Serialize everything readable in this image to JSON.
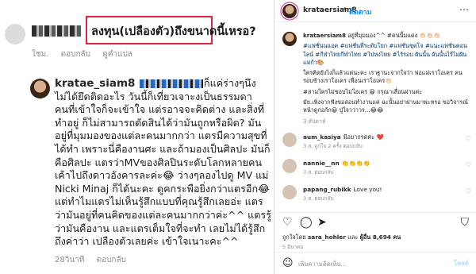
{
  "left": {
    "first_comment": {
      "text": "ลงทุน(เปลืองตัว)ถึงขนาดนี้เหรอ?",
      "time": "ใชม.",
      "reply_label": "ตอบกลับ",
      "translation_label": "ดูคำแปล"
    },
    "reply": {
      "username": "kratae_siam8",
      "lines": [
        "ก็แค่ร่างๆนึง",
        "ไม่ได้ยึดติดอะไร วันนี้ก็เที่ยวเจาะงเป็นธรรมดา",
        "คนที่เข้าใจก็จะเข้าใจ แต่รอาจจะคิดต่าง และสิ่งที่",
        "ทำอยู่ ก็ไม่สามารถตัดสินได้ว่ามันถูกหรือผิด? มัน",
        "อยู่ที่มุมมองของแต่ละคนมากกว่า แตรมีความสุขที่",
        "ได้ทำ เพราะนี่คืองานศะ และถ้ามองเป็นศิลปะ มันก็",
        "คือศิลปะ แตรว่าMVของศิลปินระดับโลกหลายคน",
        "เค้าไปถึงดาวอังคารละค่ะ😂 ว่างๆลองไปดู MV แม่",
        "Nicki Minaj ก็ได้นะคะ ดูคกระพือยิ่งกว่าแตรอีก😂",
        "แต่ทำไมแตรไม่เห็นรู้สึกแบบที่คุณรู้สึกเลยอ่ะ แตร",
        "ว่ามันอยู่ที่คนคิดของแต่ละคนมากกว่าค่ะ^^ แตรรู้",
        "ว่ามันคืองาน และแตรเต็มใจที่จะทำ เลยไม่ได้รู้สึก",
        "ถึงค่าว่า เปลืองตัวเลยค่ะ เข้าใจเนาะคะ^^"
      ],
      "time": "28วินาที",
      "reply_label": "ตอบกลับ"
    }
  },
  "post": {
    "header": {
      "username": "krataersiam8",
      "dot": "•",
      "follow_label": "ติดตาม",
      "more_icon": "more-icon"
    },
    "caption": {
      "username": "krataersiam8",
      "text": "อยู่ที่มุมมอง^^ #คนนี้มแดง 👏🏻👏🏻👏🏻",
      "hashtags": "#แฟชั่นนแอค #แฟชั่นที่ระดับโยก #แฟชั่นชุดโจ #แนะแฟชั่นคอนไลน์ #กีฬาไทยกีฬาไทย #ไปหงไทย #ไร้รอบ ผันนั้น ผันนั้นไร้ไม่ผันแม่ก้า🎨",
      "para2": "ใครคิดยังไงก็แล้วแต่นะคะ เราฐานะจากใจว่า พ่อแม่เราโอเคร คนรอบข้างเราโอเคร เพื่อนเราโอเคร👏🏻",
      "para3": "#สามใครไม่ชอบไม่โอเคร 😀 กรุณาเลื่อนผ่านค่ะ",
      "para4": "มัย.เพิ่งจากฟังขอสอนทำงานแค่ ฉะนั้นอย่าผ่านมาพ่ะหรอ ขอวิจารณ์หน้าดูก่อก้ก😀 ปู่ใจวว่าวร...😂😂",
      "time": "3 สัปดาห์"
    },
    "comments": [
      {
        "user": "aum_kasiya",
        "text": "มีอยากรดค่ะ ❤️",
        "meta": "3 ส. ถูกใจ 2 ครั้ง ตอบกลับ"
      },
      {
        "user": "nannie__nn",
        "text": "👏👏👏👏",
        "meta": "3 ส. ตอบกลับ"
      },
      {
        "user": "papang_rubikk",
        "text": "Love you!",
        "meta": "3 ส. ตอบกลับ"
      }
    ],
    "likes": {
      "prefix": "ถูกใจโดย",
      "user": "sara_hohler",
      "suffix": "และ",
      "others": "ผู้อื่น 8,694 คน"
    },
    "date": "5 มีนาคม",
    "add_comment": {
      "placeholder": "เพิ่มความคิดเห็น...",
      "post_label": "โพสต์"
    },
    "colors": {
      "accent": "#0095f6",
      "highlight_box": "#e0243c",
      "muted": "#8e8e8e"
    }
  }
}
